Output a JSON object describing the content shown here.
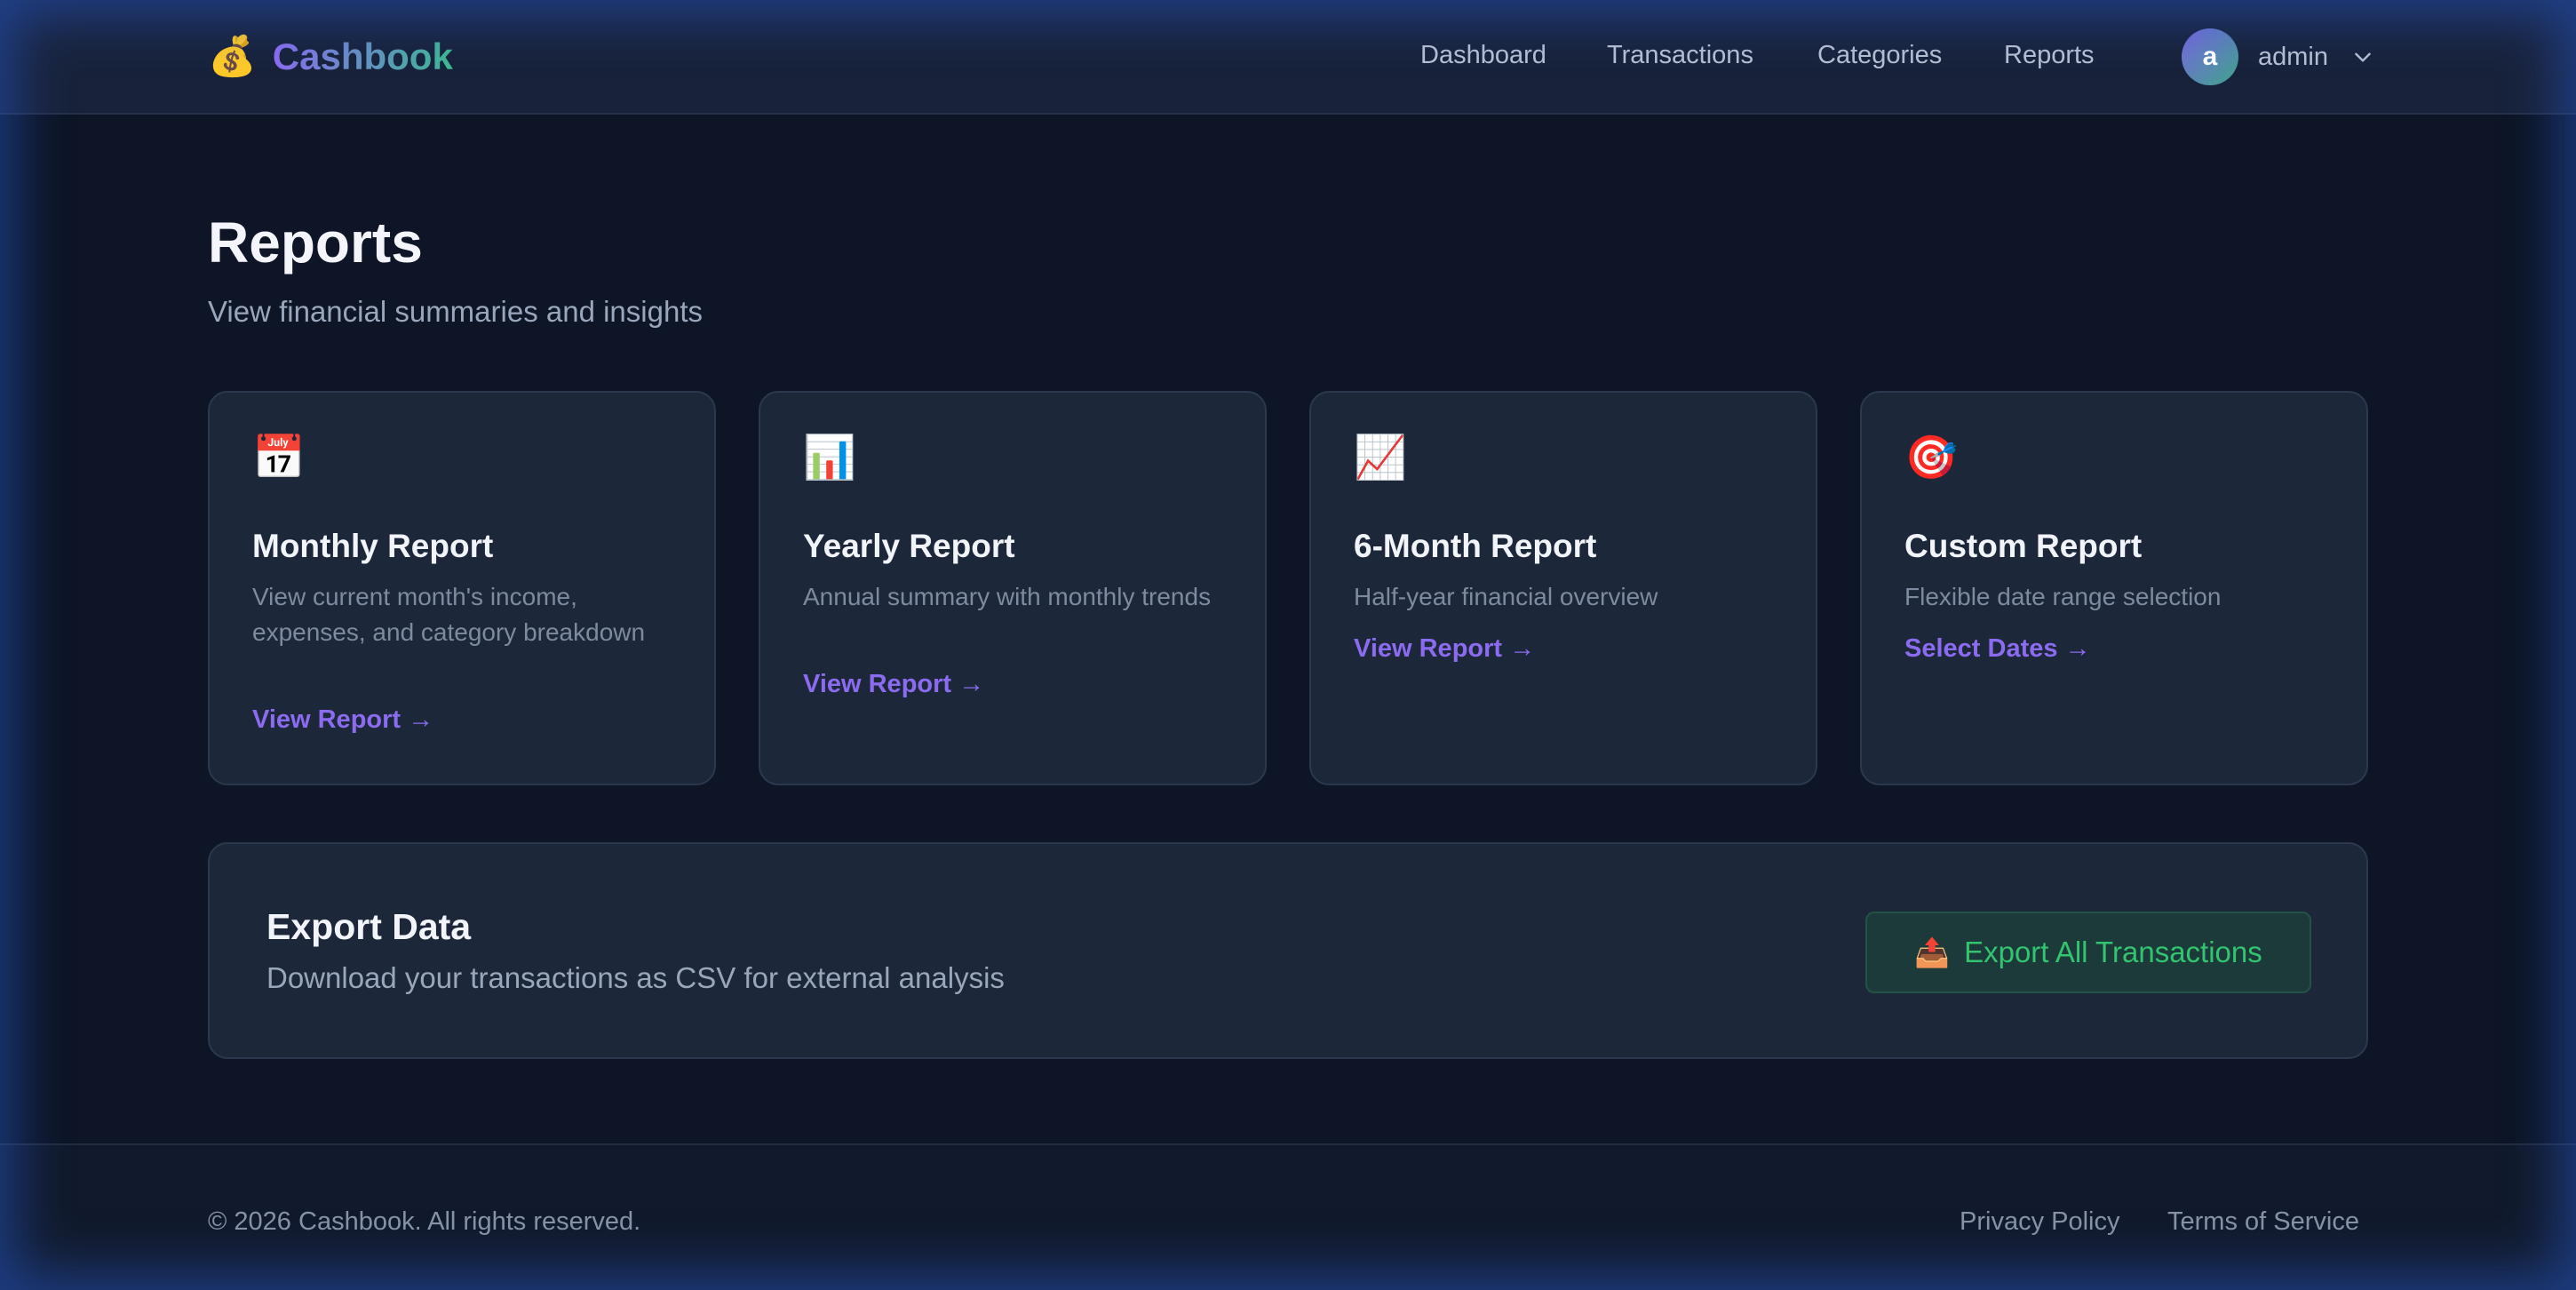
{
  "header": {
    "brand_icon": "💰",
    "brand_name": "Cashbook",
    "nav": [
      {
        "label": "Dashboard"
      },
      {
        "label": "Transactions"
      },
      {
        "label": "Categories"
      },
      {
        "label": "Reports"
      }
    ],
    "user": {
      "initial": "a",
      "name": "admin"
    }
  },
  "page": {
    "title": "Reports",
    "subtitle": "View financial summaries and insights"
  },
  "cards": [
    {
      "icon": "📅",
      "title": "Monthly Report",
      "description": "View current month's income, expenses, and category breakdown",
      "link": "View Report →"
    },
    {
      "icon": "📊",
      "title": "Yearly Report",
      "description": "Annual summary with monthly trends",
      "link": "View Report →"
    },
    {
      "icon": "📈",
      "title": "6-Month Report",
      "description": "Half-year financial overview",
      "link": "View Report →"
    },
    {
      "icon": "🎯",
      "title": "Custom Report",
      "description": "Flexible date range selection",
      "link": "Select Dates →"
    }
  ],
  "export": {
    "title": "Export Data",
    "description": "Download your transactions as CSV for external analysis",
    "button_icon": "📤",
    "button_label": "Export All Transactions"
  },
  "footer": {
    "copyright": "© 2026 Cashbook. All rights reserved.",
    "links": [
      {
        "label": "Privacy Policy"
      },
      {
        "label": "Terms of Service"
      }
    ]
  },
  "colors": {
    "background": "#0d1526",
    "accent_purple": "#8b6cf0",
    "accent_green": "#33c46f"
  }
}
